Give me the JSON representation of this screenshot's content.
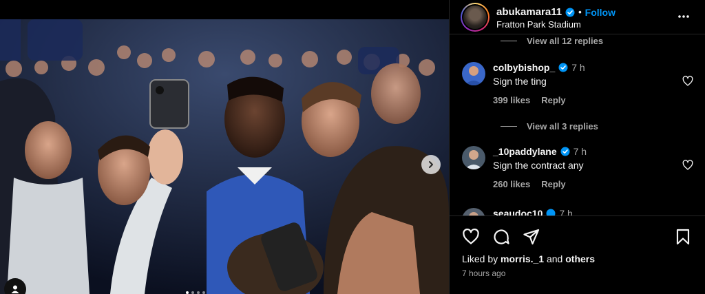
{
  "post": {
    "username": "abukamara11",
    "follow_label": "Follow",
    "separator": "•",
    "location": "Fratton Park Stadium"
  },
  "comments": {
    "top_view_replies": "View all 12 replies",
    "items": [
      {
        "username": "colbybishop_",
        "time": "7 h",
        "text": "Sign the ting",
        "likes": "399 likes",
        "reply_label": "Reply"
      },
      {
        "username": "_10paddylane",
        "time": "7 h",
        "text": "Sign the contract any",
        "likes": "260 likes",
        "reply_label": "Reply"
      },
      {
        "username": "seaudoc10",
        "time": "7 h"
      }
    ],
    "mid_view_replies": "View all 3 replies"
  },
  "footer": {
    "liked_by_prefix": "Liked by",
    "liked_by_user": "morris._1",
    "liked_by_and": "and",
    "liked_by_others": "others",
    "time_ago": "7 hours ago"
  },
  "colors": {
    "accent": "#0095f6",
    "muted": "#a8a8a8",
    "border": "#262626"
  },
  "icons": [
    "chevron-right-icon",
    "user-tag-icon",
    "verified-icon",
    "more-icon",
    "heart-icon",
    "comment-icon",
    "share-icon",
    "bookmark-icon"
  ]
}
